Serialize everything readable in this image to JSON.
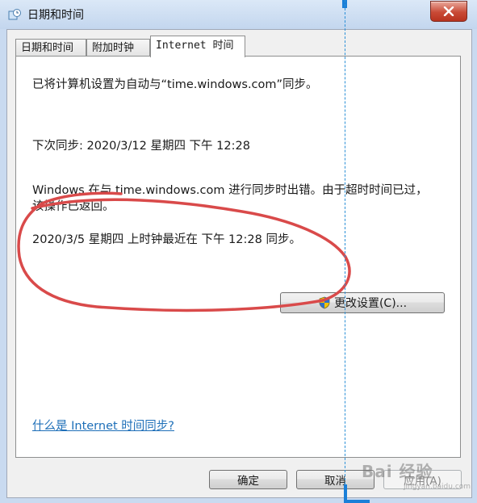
{
  "window": {
    "title": "日期和时间",
    "icon": "datetime-clock-icon",
    "close_icon": "close-icon"
  },
  "tabs": [
    {
      "label": "日期和时间",
      "active": false
    },
    {
      "label": "附加时钟",
      "active": false
    },
    {
      "label": "Internet 时间",
      "active": true
    }
  ],
  "internet_time": {
    "configured_text": "已将计算机设置为自动与“time.windows.com”同步。",
    "next_sync": "下次同步: 2020/3/12 星期四 下午 12:28",
    "error_line1": "Windows 在与 time.windows.com 进行同步时出错。由于超时时间已过，",
    "error_line2": "该操作已返回。",
    "last_sync": "2020/3/5 星期四 上时钟最近在 下午 12:28 同步。",
    "change_settings_label": "更改设置(C)...",
    "help_link": "什么是 Internet 时间同步?"
  },
  "buttons": {
    "ok": "确定",
    "cancel": "取消",
    "apply": "应用(A)"
  },
  "watermark": {
    "text": "Bai 经验",
    "sub": "jingyan.baidu.com"
  },
  "colors": {
    "annotation": "#d94a4a",
    "guide_line": "#2a8fd6",
    "link": "#1e6fb8"
  }
}
